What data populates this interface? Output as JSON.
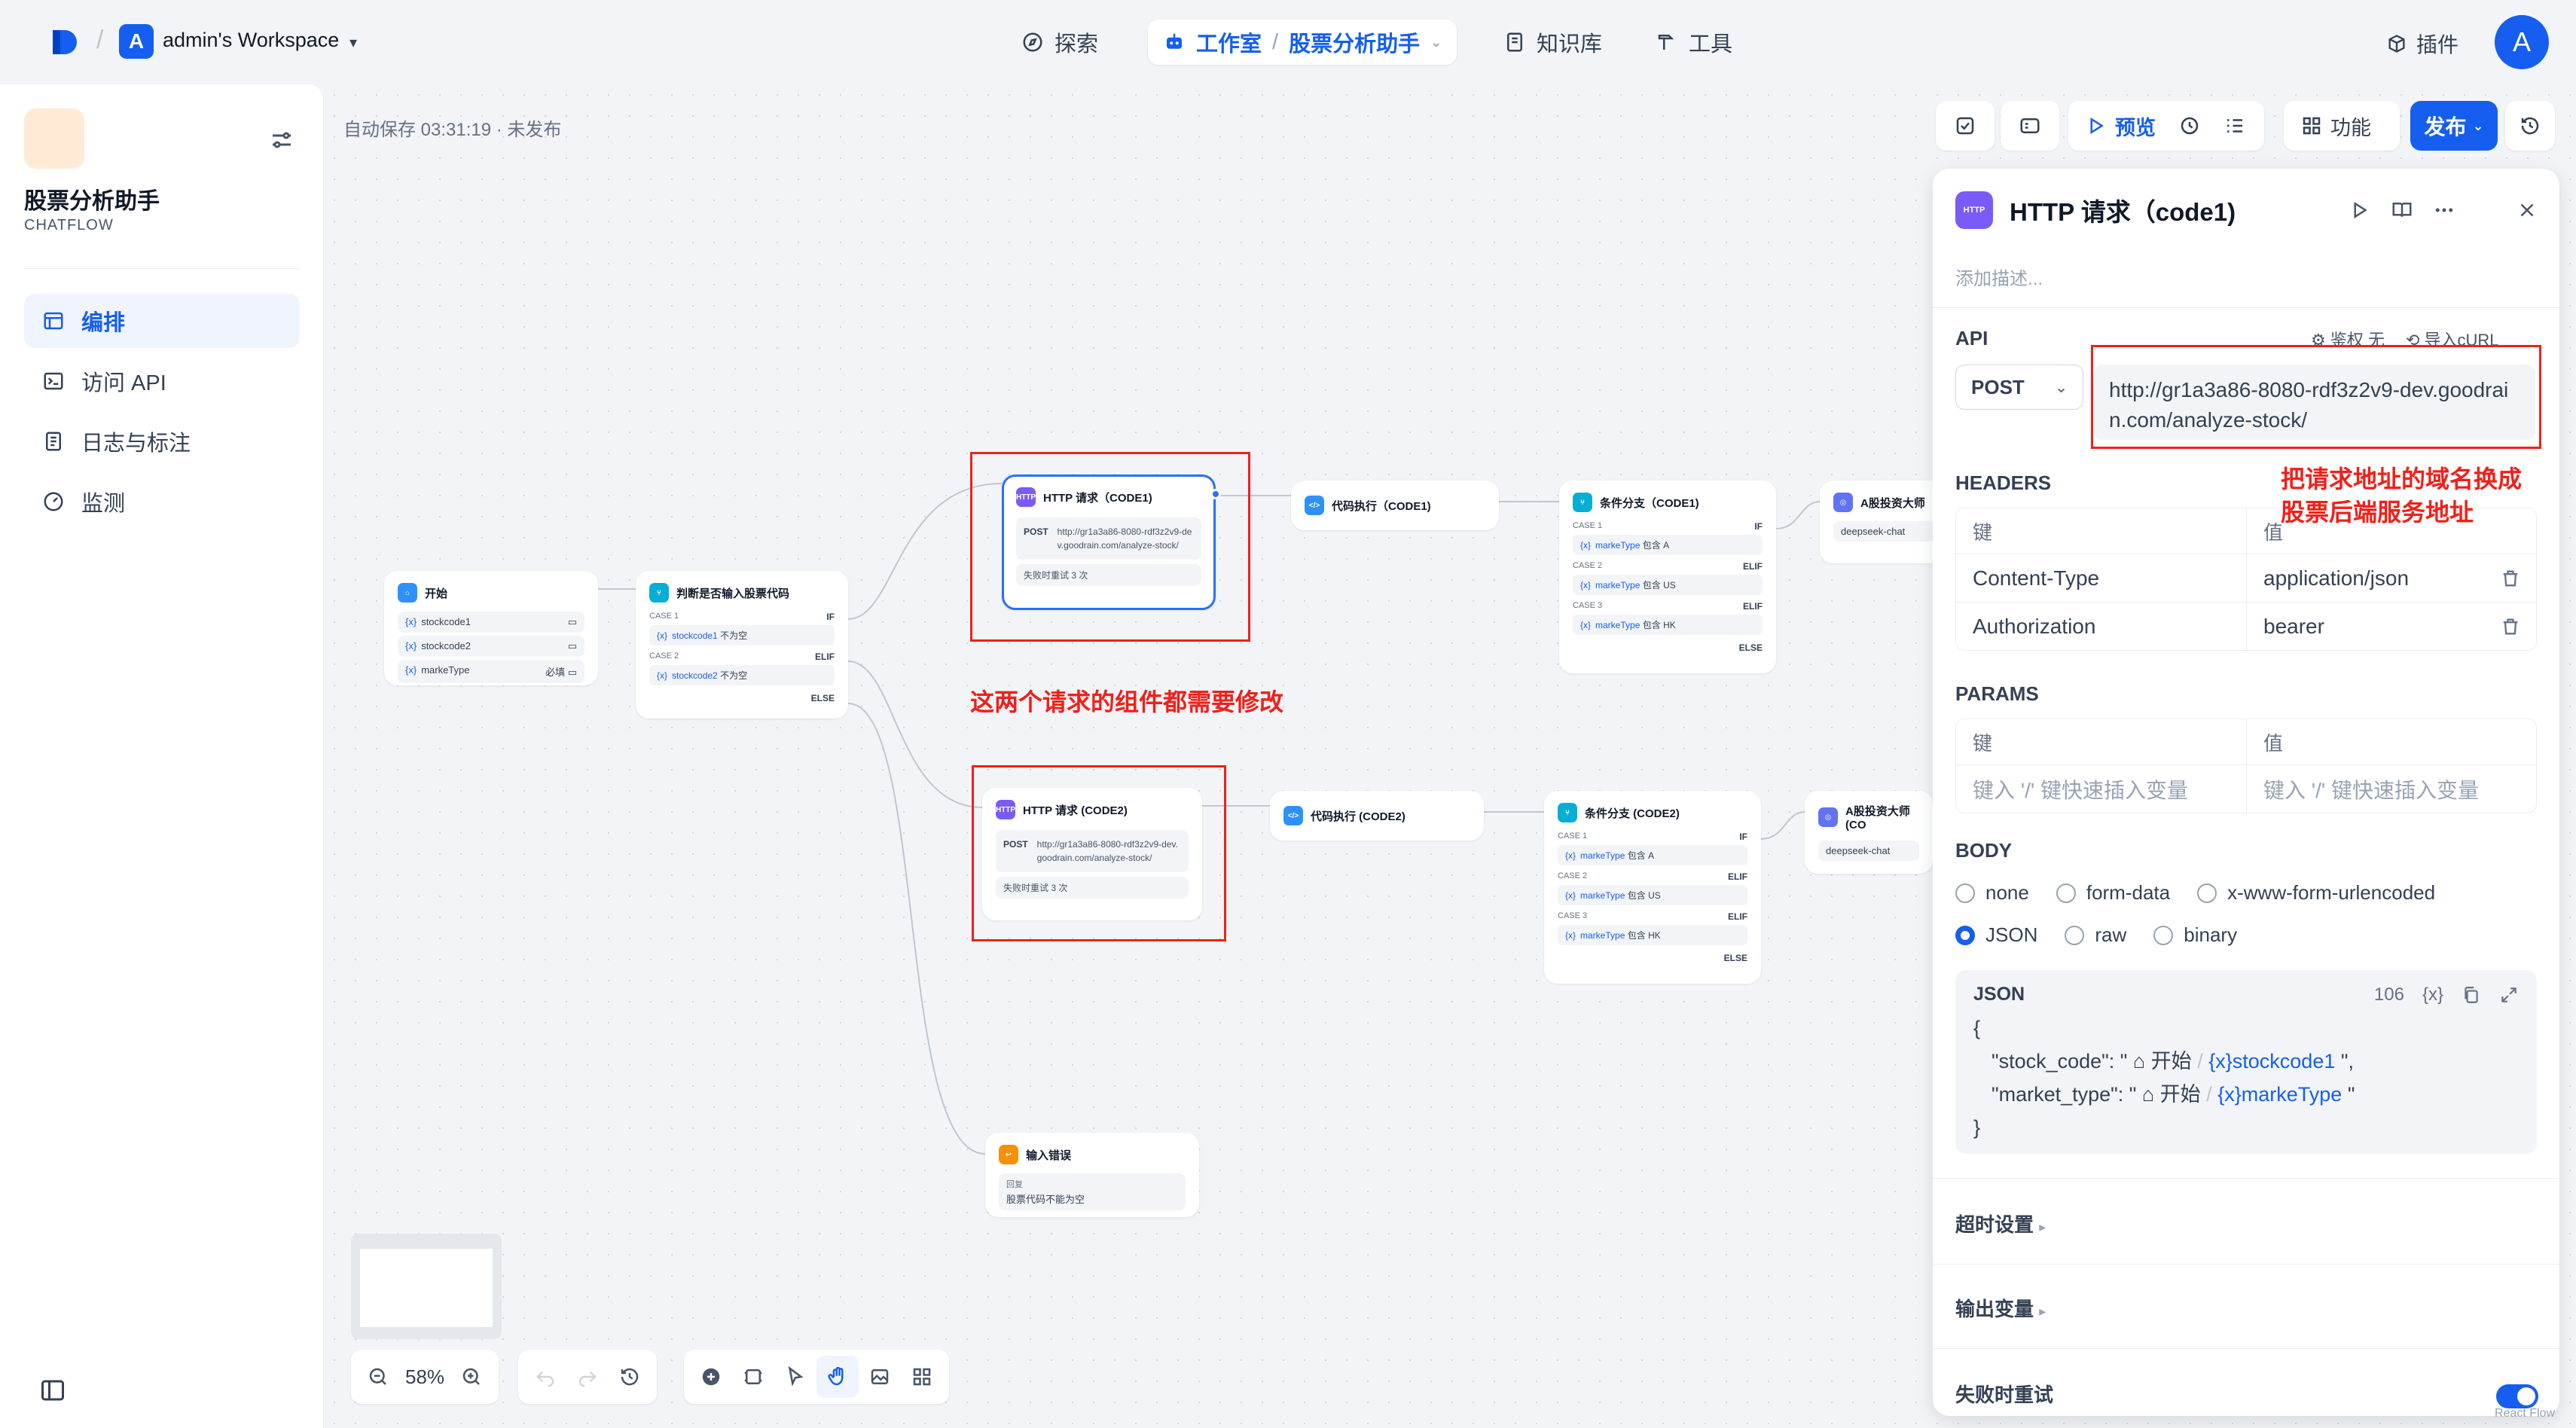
{
  "header": {
    "workspace_initial": "A",
    "workspace_name": "admin's Workspace",
    "nav_explore": "探索",
    "nav_studio": "工作室",
    "nav_sep": "/",
    "nav_app": "股票分析助手",
    "nav_knowledge": "知识库",
    "nav_tools": "工具",
    "plugins": "插件",
    "user_initial": "A"
  },
  "sidebar": {
    "app_name": "股票分析助手",
    "app_type": "CHATFLOW",
    "items": [
      {
        "label": "编排"
      },
      {
        "label": "访问 API"
      },
      {
        "label": "日志与标注"
      },
      {
        "label": "监测"
      }
    ]
  },
  "canvas": {
    "autosave": "自动保存 03:31:19 · 未发布",
    "zoom": "58%",
    "annotation_middle": "这两个请求的组件都需要修改",
    "annotation_right_1": "把请求地址的域名换成",
    "annotation_right_2": "股票后端服务地址",
    "nodes": {
      "start": {
        "title": "开始",
        "vars": [
          "stockcode1",
          "stockcode2",
          "markeType"
        ],
        "required": "必填"
      },
      "judge": {
        "title": "判断是否输入股票代码",
        "case1": "CASE 1",
        "case2": "CASE 2",
        "if": "IF",
        "elif": "ELIF",
        "else": "ELSE",
        "cond1_var": "stockcode1",
        "cond1_op": "不为空",
        "cond2_var": "stockcode2",
        "cond2_op": "不为空"
      },
      "http1": {
        "title": "HTTP 请求（CODE1)",
        "method": "POST",
        "url": "http://gr1a3a86-8080-rdf3z2v9-dev.goodrain.com/analyze-stock/",
        "retry": "失败时重试 3 次"
      },
      "http2": {
        "title": "HTTP 请求 (CODE2)",
        "method": "POST",
        "url": "http://gr1a3a86-8080-rdf3z2v9-dev.goodrain.com/analyze-stock/",
        "retry": "失败时重试 3 次"
      },
      "code1": {
        "title": "代码执行（CODE1)"
      },
      "code2": {
        "title": "代码执行 (CODE2)"
      },
      "branch1": {
        "title": "条件分支（CODE1)"
      },
      "branch2": {
        "title": "条件分支 (CODE2)"
      },
      "branch_cases": {
        "case1": "CASE 1",
        "case2": "CASE 2",
        "case3": "CASE 3",
        "if": "IF",
        "elif": "ELIF",
        "else": "ELSE",
        "var": "markeType",
        "op": "包含",
        "val1": "A",
        "val2": "US",
        "val3": "HK"
      },
      "llm1": {
        "title": "A股投资大师",
        "model": "deepseek-chat"
      },
      "llm2": {
        "title": "A股投资大师 (CO",
        "model": "deepseek-chat"
      },
      "error": {
        "title": "输入错误",
        "label": "回复",
        "text": "股票代码不能为空"
      }
    }
  },
  "top_actions": {
    "preview": "预览",
    "features": "功能",
    "publish": "发布"
  },
  "panel": {
    "icon_text": "HTTP",
    "title": "HTTP 请求（code1)",
    "description_placeholder": "添加描述...",
    "api_label": "API",
    "auth": "鉴权 无",
    "import_curl": "导入cURL",
    "method": "POST",
    "url": "http://gr1a3a86-8080-rdf3z2v9-dev.goodrain.com/analyze-stock/",
    "headers_label": "HEADERS",
    "key_col": "键",
    "value_col": "值",
    "headers": [
      {
        "key": "Content-Type",
        "value": "application/json"
      },
      {
        "key": "Authorization",
        "value": "bearer"
      }
    ],
    "params_label": "PARAMS",
    "params_key_placeholder": "键入 '/' 键快速插入变量",
    "params_value_placeholder": "键入 '/' 键快速插入变量",
    "body_label": "BODY",
    "body_options": [
      "none",
      "form-data",
      "x-www-form-urlencoded",
      "JSON",
      "raw",
      "binary"
    ],
    "body_selected": "JSON",
    "json_label": "JSON",
    "json_count": "106",
    "json_open": "{",
    "json_close": "}",
    "json_line1_key": "\"stock_code\": \"",
    "json_line1_node": "开始",
    "json_line1_var": "stockcode1",
    "json_line1_end": "\",",
    "json_line2_key": "\"market_type\": \"",
    "json_line2_node": "开始",
    "json_line2_var": "markeType",
    "json_line2_end": "\"",
    "timeout_label": "超时设置",
    "output_label": "输出变量",
    "retry_label": "失败时重试",
    "retry_enabled": true,
    "attribution": "React Flow"
  }
}
